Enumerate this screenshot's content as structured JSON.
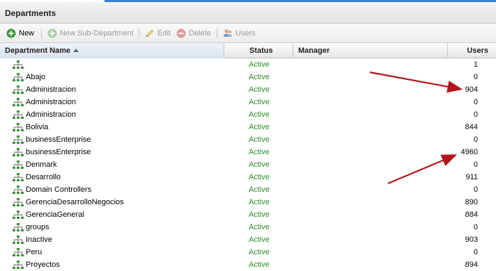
{
  "panel": {
    "title": "Departments"
  },
  "toolbar": {
    "new": {
      "label": "New",
      "icon": "plus-circle-icon",
      "color": "#3a9a3a"
    },
    "new_sub": {
      "label": "New Sub-Department",
      "icon": "plus-circle-icon"
    },
    "edit": {
      "label": "Edit",
      "icon": "pencil-icon"
    },
    "delete": {
      "label": "Delete",
      "icon": "minus-circle-icon"
    },
    "users": {
      "label": "Users",
      "icon": "users-icon"
    }
  },
  "columns": {
    "name": "Department Name",
    "status": "Status",
    "manager": "Manager",
    "users": "Users"
  },
  "rows": [
    {
      "name": "",
      "status": "Active",
      "manager": "",
      "users": "1"
    },
    {
      "name": "Abajo",
      "status": "Active",
      "manager": "",
      "users": "0"
    },
    {
      "name": "Administracion",
      "status": "Active",
      "manager": "",
      "users": "904"
    },
    {
      "name": "Administracion",
      "status": "Active",
      "manager": "",
      "users": "0"
    },
    {
      "name": "Administracion",
      "status": "Active",
      "manager": "",
      "users": "0"
    },
    {
      "name": "Bolivia",
      "status": "Active",
      "manager": "",
      "users": "844"
    },
    {
      "name": "businessEnterprise",
      "status": "Active",
      "manager": "",
      "users": "0"
    },
    {
      "name": "businessEnterprise",
      "status": "Active",
      "manager": "",
      "users": "4960"
    },
    {
      "name": "Denmark",
      "status": "Active",
      "manager": "",
      "users": "0"
    },
    {
      "name": "Desarrollo",
      "status": "Active",
      "manager": "",
      "users": "911"
    },
    {
      "name": "Domain Controllers",
      "status": "Active",
      "manager": "",
      "users": "0"
    },
    {
      "name": "GerenciaDesarrolloNegocios",
      "status": "Active",
      "manager": "",
      "users": "890"
    },
    {
      "name": "GerenciaGeneral",
      "status": "Active",
      "manager": "",
      "users": "884"
    },
    {
      "name": "groups",
      "status": "Active",
      "manager": "",
      "users": "0"
    },
    {
      "name": "Inactive",
      "status": "Active",
      "manager": "",
      "users": "903"
    },
    {
      "name": "Peru",
      "status": "Active",
      "manager": "",
      "users": "0"
    },
    {
      "name": "Proyectos",
      "status": "Active",
      "manager": "",
      "users": "894"
    }
  ],
  "colors": {
    "status_active": "#2e8a2e",
    "accent_line": "#3b7ec9",
    "annotation_arrow": "#b3141b"
  }
}
